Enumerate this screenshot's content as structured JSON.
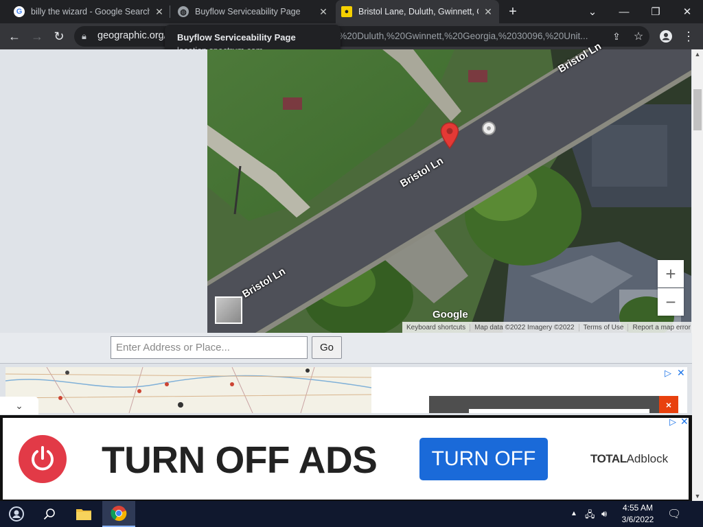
{
  "browser": {
    "tabs": [
      {
        "title": "billy the wizard - Google Search",
        "favicon": "google-g-icon",
        "active": false
      },
      {
        "title": "Buyflow Serviceability Page",
        "favicon": "globe-icon",
        "active": false
      },
      {
        "title": "Bristol Lane, Duluth, Gwinnett, Georgia",
        "favicon": "geographic-favicon",
        "active": true
      }
    ],
    "new_tab": "+",
    "window_controls": {
      "menu": "⌄",
      "minimize": "—",
      "restore": "❐",
      "close": "✕"
    },
    "url_host": "geographic.org/",
    "url_rest": "e,%20Duluth,%20Gwinnett,%20Georgia,%2030096,%20Unit...",
    "tooltip": {
      "title": "Buyflow Serviceability Page",
      "subtitle": "location.spectrum.com"
    }
  },
  "map": {
    "street_labels": [
      "Bristol Ln",
      "Bristol Ln",
      "Bristol Ln"
    ],
    "zoom_in": "+",
    "zoom_out": "−",
    "google": "Google",
    "attribution": [
      "Keyboard shortcuts",
      "Map data ©2022 Imagery ©2022",
      "Terms of Use",
      "Report a map error"
    ]
  },
  "search": {
    "placeholder": "Enter Address or Place...",
    "go_label": "Go"
  },
  "lower": {
    "collapse": "⌄",
    "video_close": "×",
    "adchoice": "▷",
    "ad_close": "✕"
  },
  "ad": {
    "headline": "TURN OFF ADS",
    "button": "TURN OFF",
    "brand_bold": "TOTAL",
    "brand_rest": "Adblock",
    "adchoice": "▷",
    "close": "✕"
  },
  "taskbar": {
    "time": "4:55 AM",
    "date": "3/6/2022"
  },
  "colors": {
    "accent": "#1a6ad9",
    "power": "#e23a47",
    "pin": "#e53935"
  }
}
